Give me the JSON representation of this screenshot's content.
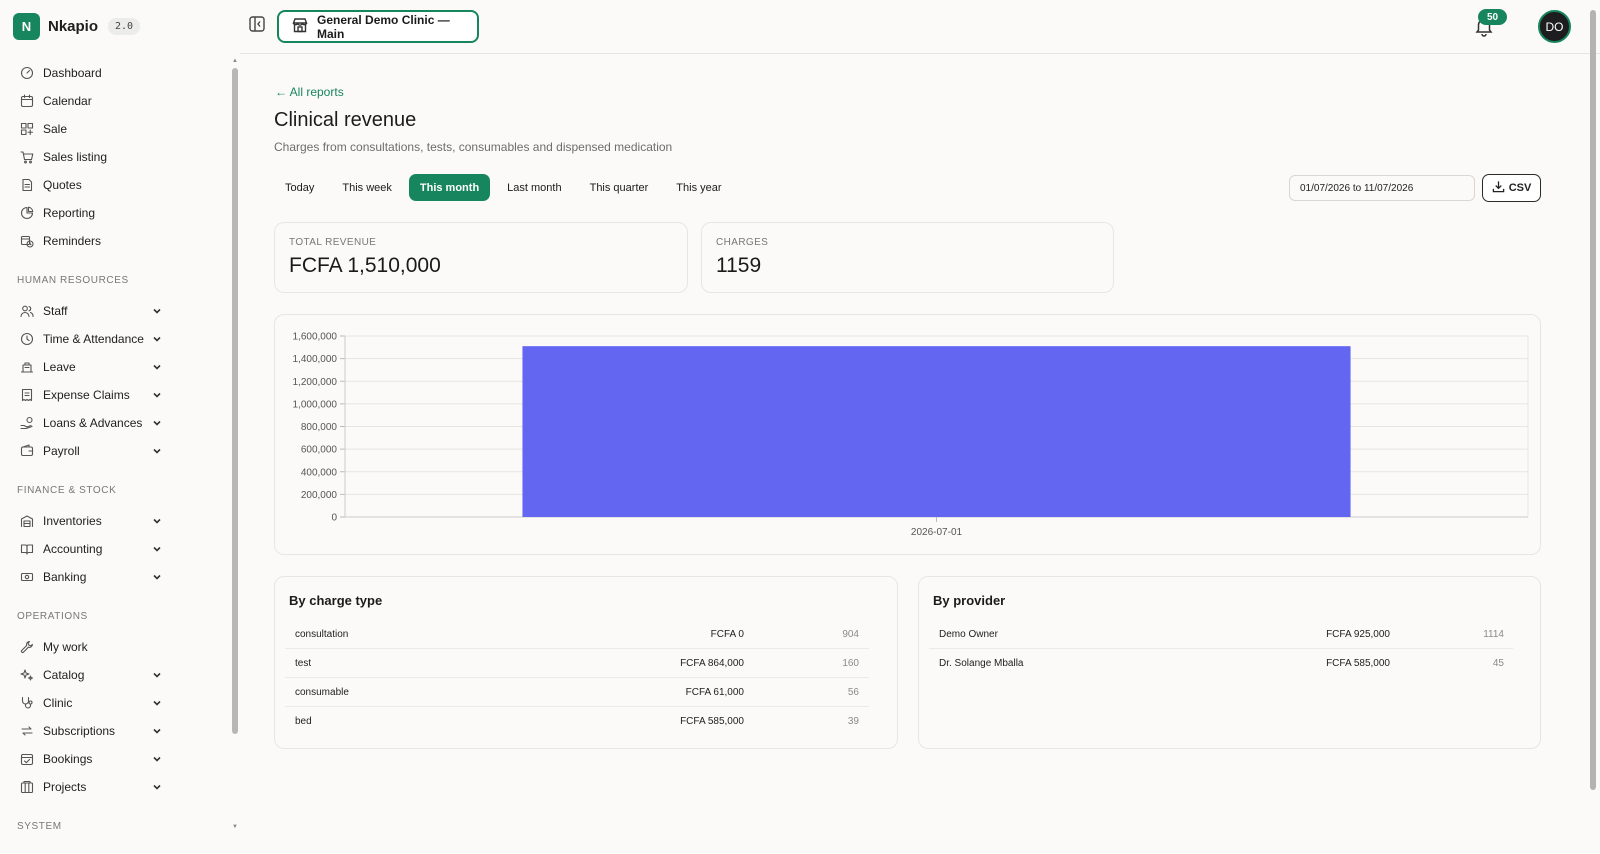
{
  "brand": {
    "logo_letter": "N",
    "name": "Nkapio",
    "version": "2.0"
  },
  "sidebar": {
    "sections": [
      {
        "title": "",
        "items": [
          {
            "label": "Dashboard",
            "icon": "gauge-icon",
            "expandable": false
          },
          {
            "label": "Calendar",
            "icon": "calendar-icon",
            "expandable": false
          },
          {
            "label": "Sale",
            "icon": "grid-plus-icon",
            "expandable": false
          },
          {
            "label": "Sales listing",
            "icon": "cart-icon",
            "expandable": false
          },
          {
            "label": "Quotes",
            "icon": "document-icon",
            "expandable": false
          },
          {
            "label": "Reporting",
            "icon": "pie-chart-icon",
            "expandable": false
          },
          {
            "label": "Reminders",
            "icon": "calendar-clock-icon",
            "expandable": false
          }
        ]
      },
      {
        "title": "HUMAN RESOURCES",
        "items": [
          {
            "label": "Staff",
            "icon": "users-icon",
            "expandable": true
          },
          {
            "label": "Time & Attendance",
            "icon": "clock-icon",
            "expandable": true
          },
          {
            "label": "Leave",
            "icon": "plane-icon",
            "expandable": true
          },
          {
            "label": "Expense Claims",
            "icon": "receipt-icon",
            "expandable": true
          },
          {
            "label": "Loans & Advances",
            "icon": "hand-coins-icon",
            "expandable": true
          },
          {
            "label": "Payroll",
            "icon": "wallet-icon",
            "expandable": true
          }
        ]
      },
      {
        "title": "FINANCE & STOCK",
        "items": [
          {
            "label": "Inventories",
            "icon": "warehouse-icon",
            "expandable": true
          },
          {
            "label": "Accounting",
            "icon": "book-open-icon",
            "expandable": true
          },
          {
            "label": "Banking",
            "icon": "banknote-icon",
            "expandable": true
          }
        ]
      },
      {
        "title": "OPERATIONS",
        "items": [
          {
            "label": "My work",
            "icon": "wrench-icon",
            "expandable": false
          },
          {
            "label": "Catalog",
            "icon": "sparkles-icon",
            "expandable": true
          },
          {
            "label": "Clinic",
            "icon": "stethoscope-icon",
            "expandable": true
          },
          {
            "label": "Subscriptions",
            "icon": "repeat-icon",
            "expandable": true
          },
          {
            "label": "Bookings",
            "icon": "calendar-check-icon",
            "expandable": true
          },
          {
            "label": "Projects",
            "icon": "columns-icon",
            "expandable": true
          }
        ]
      },
      {
        "title": "SYSTEM",
        "items": []
      }
    ]
  },
  "topbar": {
    "clinic_selector": "General Demo Clinic — Main",
    "notifications_count": "50",
    "avatar_initials": "DO"
  },
  "page": {
    "back_link": "← All reports",
    "title": "Clinical revenue",
    "subtitle": "Charges from consultations, tests, consumables and dispensed medication",
    "periods": [
      "Today",
      "This week",
      "This month",
      "Last month",
      "This quarter",
      "This year"
    ],
    "active_period": "This month",
    "date_range": "01/07/2026 to 11/07/2026",
    "csv_label": "CSV"
  },
  "stats": [
    {
      "label": "TOTAL REVENUE",
      "value": "FCFA 1,510,000"
    },
    {
      "label": "CHARGES",
      "value": "1159"
    }
  ],
  "chart_data": {
    "type": "bar",
    "categories": [
      "2026-07-01"
    ],
    "values": [
      1510000
    ],
    "ylim": [
      0,
      1600000
    ],
    "yticks": [
      0,
      200000,
      400000,
      600000,
      800000,
      1000000,
      1200000,
      1400000,
      1600000
    ],
    "ytick_labels": [
      "0",
      "200,000",
      "400,000",
      "600,000",
      "800,000",
      "1,000,000",
      "1,200,000",
      "1,400,000",
      "1,600,000"
    ],
    "bar_color": "#6366f1",
    "grid": true,
    "title": "",
    "xlabel": "",
    "ylabel": ""
  },
  "by_charge_type": {
    "title": "By charge type",
    "rows": [
      {
        "name": "consultation",
        "amount": "FCFA 0",
        "count": "904"
      },
      {
        "name": "test",
        "amount": "FCFA 864,000",
        "count": "160"
      },
      {
        "name": "consumable",
        "amount": "FCFA 61,000",
        "count": "56"
      },
      {
        "name": "bed",
        "amount": "FCFA 585,000",
        "count": "39"
      }
    ]
  },
  "by_provider": {
    "title": "By provider",
    "rows": [
      {
        "name": "Demo Owner",
        "amount": "FCFA 925,000",
        "count": "1114"
      },
      {
        "name": "Dr. Solange Mballa",
        "amount": "FCFA 585,000",
        "count": "45"
      }
    ]
  },
  "colors": {
    "accent": "#17855e",
    "bar": "#6366f1"
  }
}
